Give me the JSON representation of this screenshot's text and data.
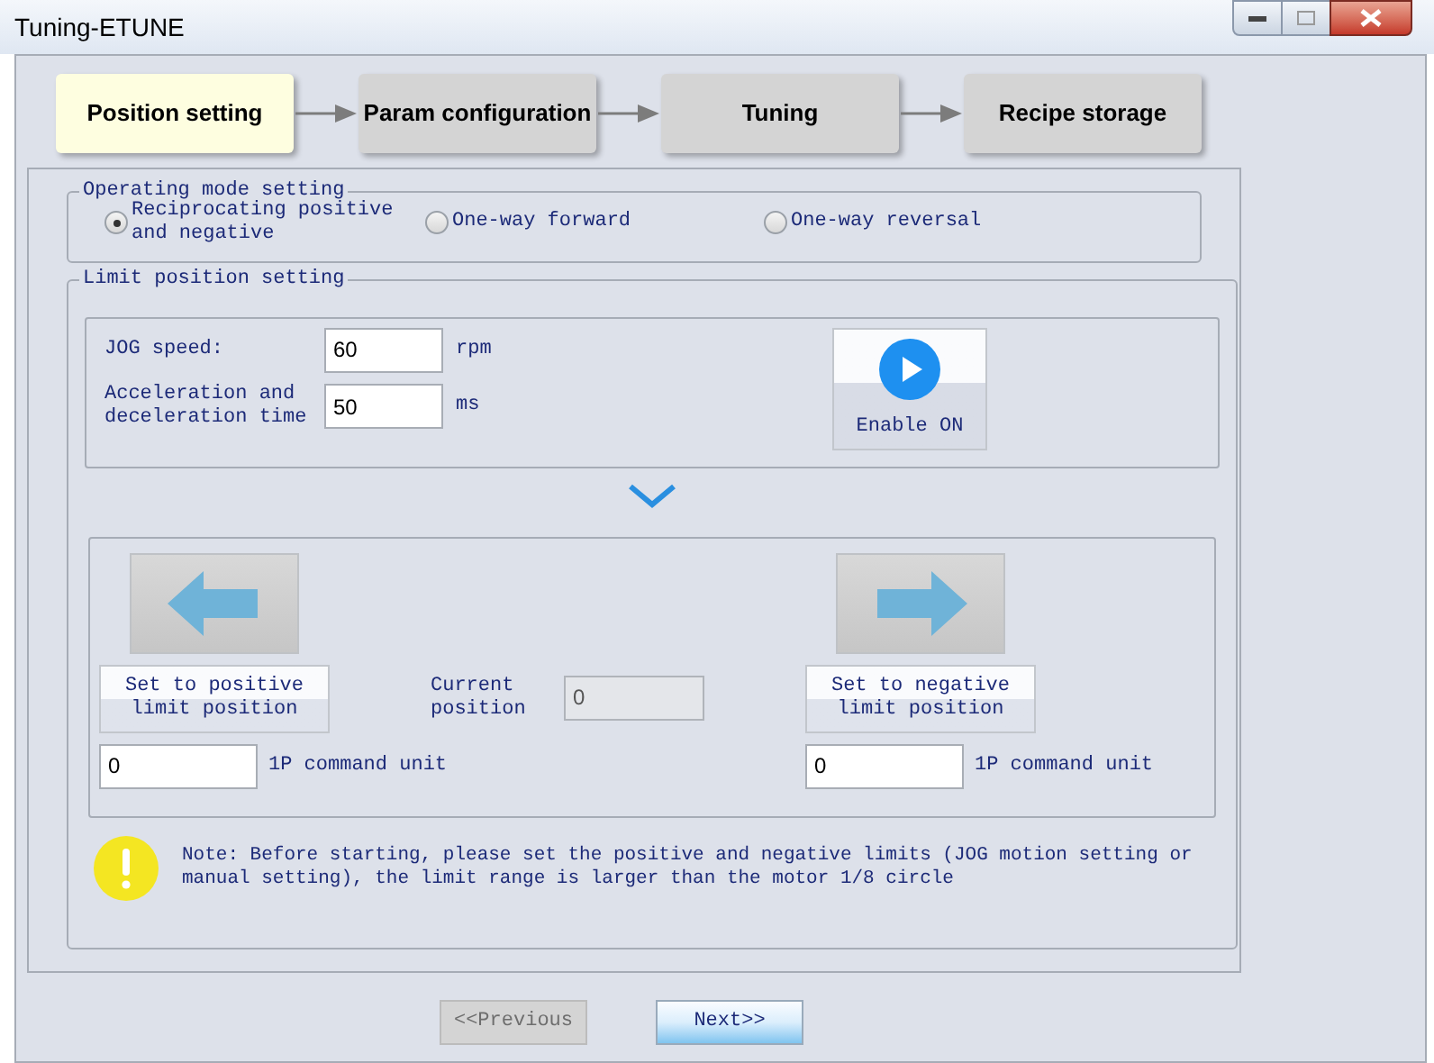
{
  "window": {
    "title": "Tuning-ETUNE"
  },
  "steps": [
    {
      "label": "Position setting",
      "selected": true
    },
    {
      "label": "Param configuration",
      "selected": false
    },
    {
      "label": "Tuning",
      "selected": false
    },
    {
      "label": "Recipe storage",
      "selected": false
    }
  ],
  "operating_mode": {
    "title": "Operating mode setting",
    "options": [
      {
        "label": "Reciprocating positive and negative",
        "selected": true
      },
      {
        "label": "One-way forward",
        "selected": false
      },
      {
        "label": "One-way reversal",
        "selected": false
      }
    ]
  },
  "limit_position": {
    "title": "Limit position setting",
    "jog_speed": {
      "label": "JOG speed:",
      "value": "60",
      "unit": "rpm"
    },
    "acceleration": {
      "label": "Acceleration and deceleration time",
      "value": "50",
      "unit": "ms"
    },
    "enable_button": {
      "label": "Enable ON"
    },
    "positive": {
      "button": "Set to positive limit position",
      "value": "0",
      "unit": "1P command unit"
    },
    "current_position": {
      "label": "Current position",
      "value": "0",
      "disabled": true
    },
    "negative": {
      "button": "Set to negative limit position",
      "value": "0",
      "unit": "1P command unit"
    },
    "note": "Note: Before starting, please set the positive and negative limits (JOG motion setting or manual setting), the limit range is larger than the motor 1/8 circle"
  },
  "buttons": [
    {
      "label": "<<Previous",
      "disabled": true
    },
    {
      "label": "Next>>",
      "disabled": false
    }
  ]
}
